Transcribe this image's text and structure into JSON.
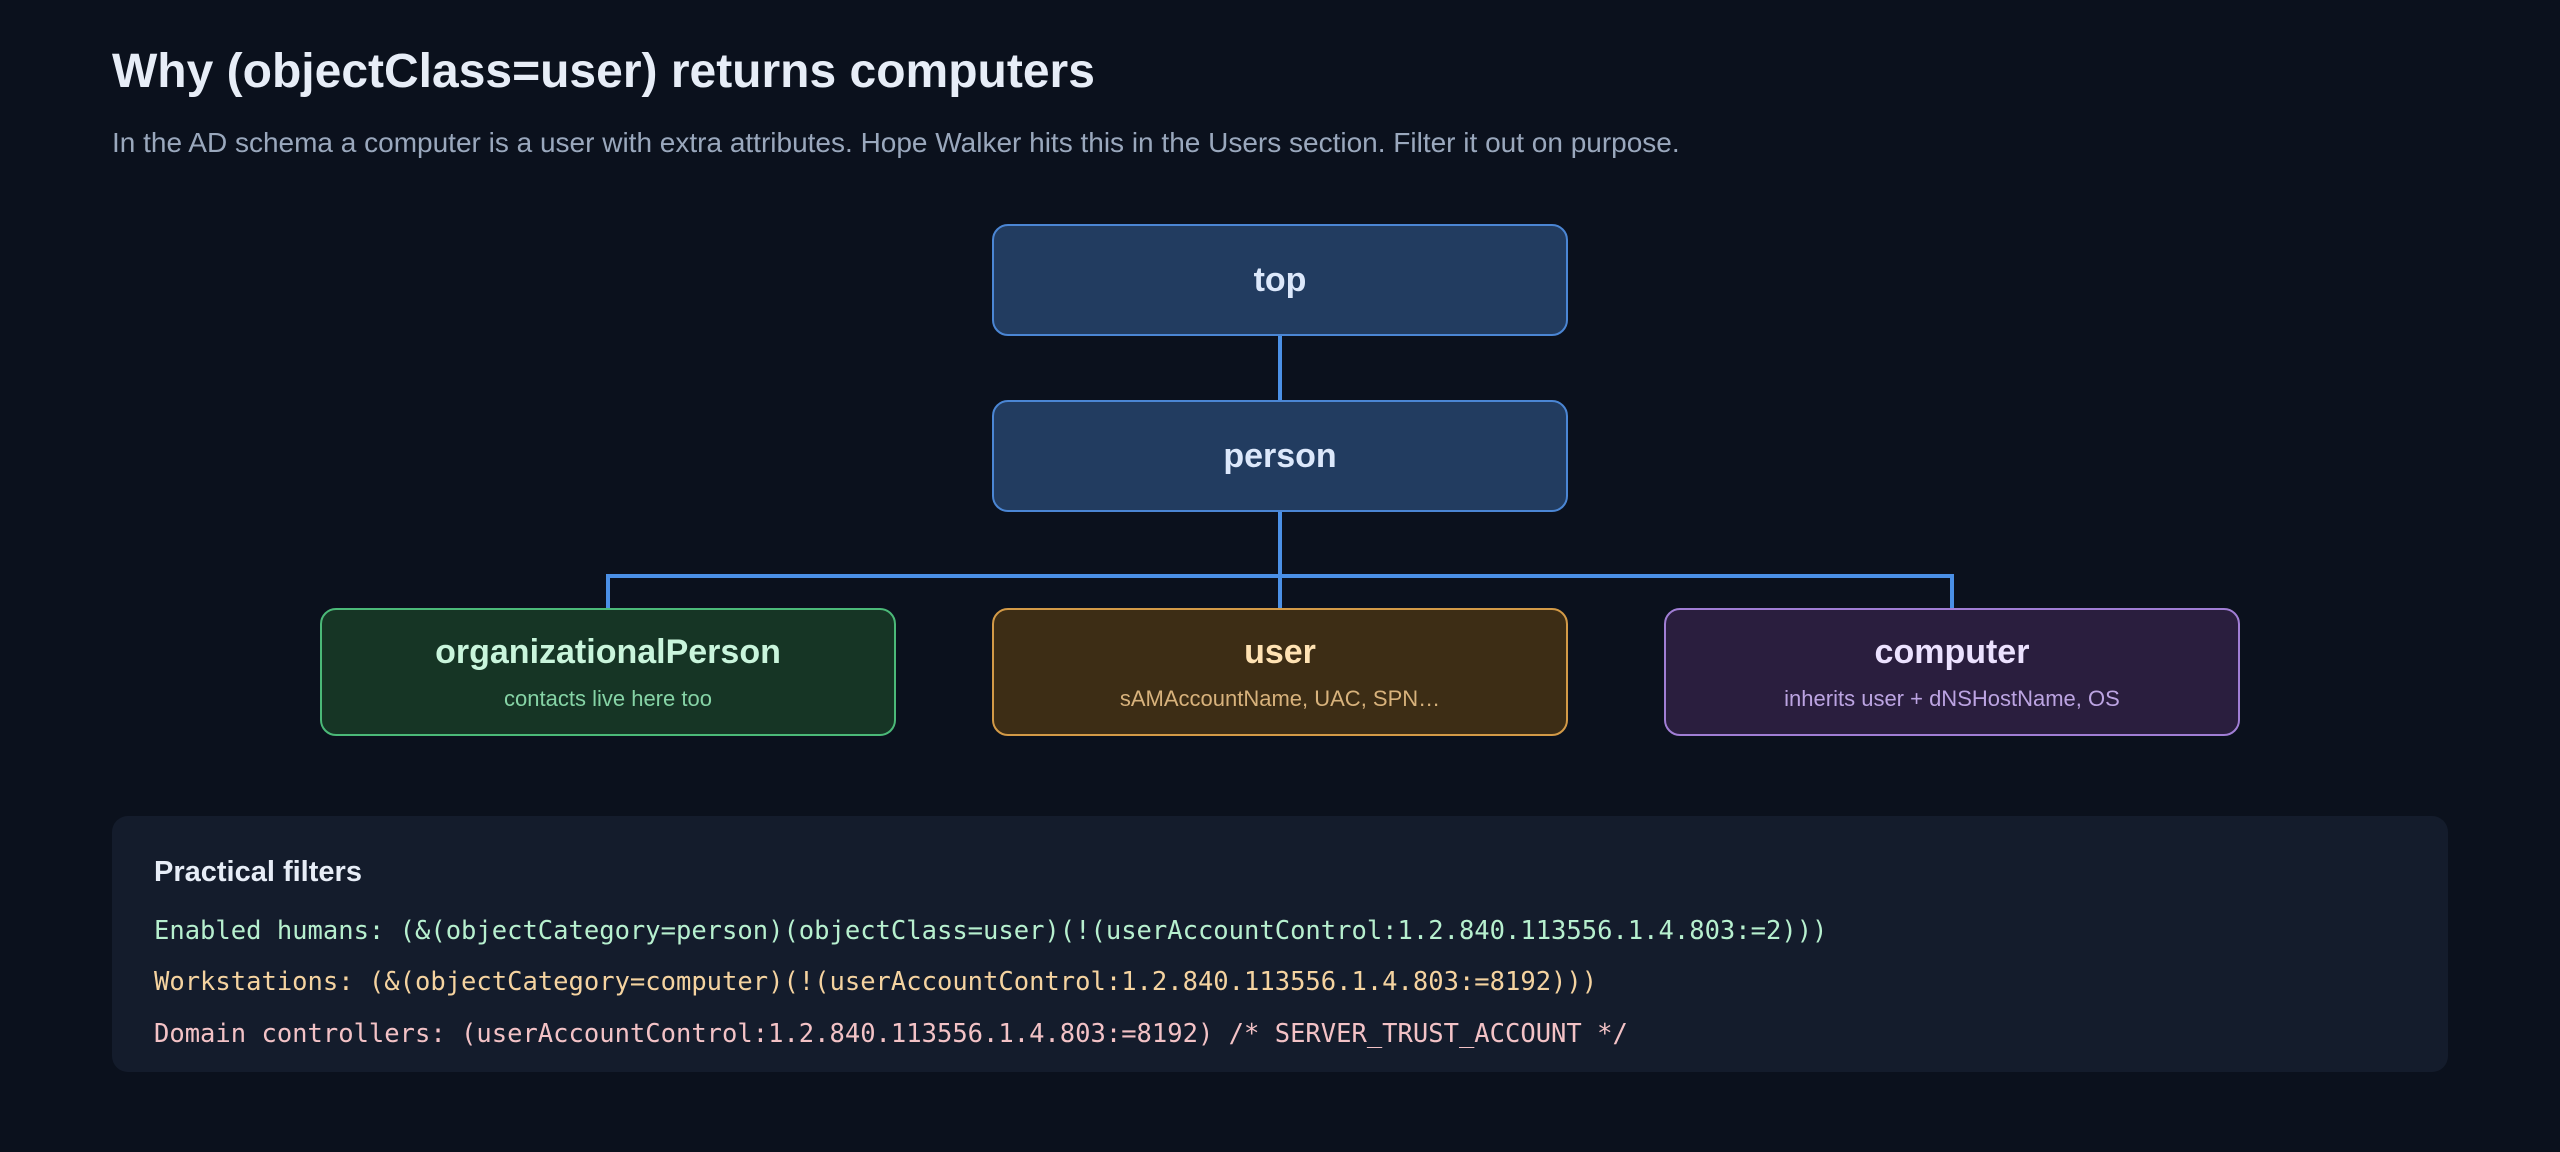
{
  "header": {
    "title": "Why (objectClass=user) returns computers",
    "subtitle": "In the AD schema a computer is a user with extra attributes. Hope Walker hits this in the Users section. Filter it out on purpose."
  },
  "diagram": {
    "nodes": {
      "top": {
        "title": "top"
      },
      "person": {
        "title": "person"
      },
      "organizationalPerson": {
        "title": "organizationalPerson",
        "note": "contacts live here too"
      },
      "user": {
        "title": "user",
        "note": "sAMAccountName, UAC, SPN…"
      },
      "computer": {
        "title": "computer",
        "note": "inherits user + dNSHostName, OS"
      }
    },
    "edges": [
      [
        "top",
        "person"
      ],
      [
        "person",
        "organizationalPerson"
      ],
      [
        "person",
        "user"
      ],
      [
        "person",
        "computer"
      ]
    ],
    "colors": {
      "connector": "#4b90e6",
      "base_node": "#223c60",
      "organizationalPerson": "#4bb978",
      "user": "#d39a47",
      "computer": "#a17ed5"
    }
  },
  "filters": {
    "title": "Practical filters",
    "lines": [
      "Enabled humans: (&(objectCategory=person)(objectClass=user)(!(userAccountControl:1.2.840.113556.1.4.803:=2)))",
      "Workstations: (&(objectCategory=computer)(!(userAccountControl:1.2.840.113556.1.4.803:=8192)))",
      "Domain controllers: (userAccountControl:1.2.840.113556.1.4.803:=8192) /* SERVER_TRUST_ACCOUNT */"
    ]
  }
}
